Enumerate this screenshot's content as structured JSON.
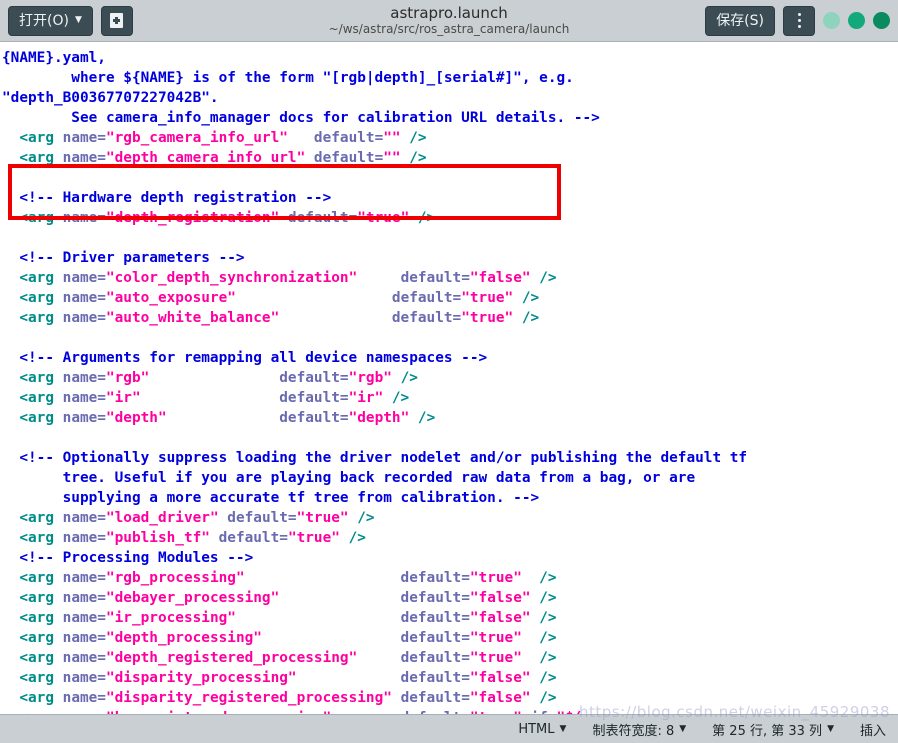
{
  "window": {
    "title": "astrapro.launch",
    "subtitle": "~/ws/astra/src/ros_astra_camera/launch"
  },
  "toolbar": {
    "open_label": "打开(O)",
    "open_caret": "▼",
    "new_doc_icon": "new-document-icon",
    "save_label": "保存(S)",
    "menu_icon": "overflow-menu-icon",
    "window_dots": [
      {
        "name": "minimize-dot",
        "color": "#8ed4bc"
      },
      {
        "name": "maximize-dot",
        "color": "#14a97c"
      },
      {
        "name": "close-dot",
        "color": "#0a8a5f"
      }
    ]
  },
  "statusbar": {
    "language": "HTML",
    "language_caret": "▼",
    "tabwidth": "制表符宽度: 8",
    "tabwidth_caret": "▼",
    "position": "第 25 行, 第 33 列",
    "position_caret": "▼",
    "insert_mode": "插入"
  },
  "watermark": "https://blog.csdn.net/weixin_45929038",
  "annotation": {
    "redbox_color": "#ee0000",
    "note": "red rectangle highlighting the two camera_info_url arg lines"
  },
  "code": {
    "language": "xml",
    "lines": [
      {
        "t": "partial-top",
        "spans": []
      },
      {
        "t": "cm",
        "spans": [
          {
            "c": "cm",
            "x": "{NAME}.yaml,"
          }
        ]
      },
      {
        "t": "cm",
        "spans": [
          {
            "c": "cm",
            "x": "        where ${NAME} is of the form \"[rgb|depth]_[serial#]\", e.g."
          }
        ]
      },
      {
        "t": "cm",
        "spans": [
          {
            "c": "cm",
            "x": "\"depth_B00367707227042B\"."
          }
        ]
      },
      {
        "t": "cm",
        "spans": [
          {
            "c": "cm",
            "x": "        See camera_info_manager docs for calibration URL details. -->"
          }
        ]
      },
      {
        "t": "arg",
        "spans": [
          {
            "c": "tg",
            "x": "  <arg "
          },
          {
            "c": "at",
            "x": "name="
          },
          {
            "c": "st",
            "x": "\"rgb_camera_info_url\""
          },
          {
            "c": "at",
            "x": "   default="
          },
          {
            "c": "st",
            "x": "\"\""
          },
          {
            "c": "tg",
            "x": " />"
          }
        ]
      },
      {
        "t": "arg",
        "spans": [
          {
            "c": "tg",
            "x": "  <arg "
          },
          {
            "c": "at",
            "x": "name="
          },
          {
            "c": "st",
            "x": "\"depth_camera_info_url\""
          },
          {
            "c": "at",
            "x": " default="
          },
          {
            "c": "st",
            "x": "\"\""
          },
          {
            "c": "tg",
            "x": " />"
          }
        ]
      },
      {
        "t": "blank",
        "spans": []
      },
      {
        "t": "cm",
        "spans": [
          {
            "c": "cm",
            "x": "  <!-- Hardware depth registration -->"
          }
        ]
      },
      {
        "t": "arg",
        "spans": [
          {
            "c": "tg",
            "x": "  <arg "
          },
          {
            "c": "at",
            "x": "name="
          },
          {
            "c": "st",
            "x": "\"depth_registration\""
          },
          {
            "c": "at",
            "x": " default="
          },
          {
            "c": "st",
            "x": "\"true\""
          },
          {
            "c": "tg",
            "x": " />"
          }
        ]
      },
      {
        "t": "blank",
        "spans": []
      },
      {
        "t": "cm",
        "spans": [
          {
            "c": "cm",
            "x": "  <!-- Driver parameters -->"
          }
        ]
      },
      {
        "t": "arg",
        "spans": [
          {
            "c": "tg",
            "x": "  <arg "
          },
          {
            "c": "at",
            "x": "name="
          },
          {
            "c": "st",
            "x": "\"color_depth_synchronization\""
          },
          {
            "c": "at",
            "x": "     default="
          },
          {
            "c": "st",
            "x": "\"false\""
          },
          {
            "c": "tg",
            "x": " />"
          }
        ]
      },
      {
        "t": "arg",
        "spans": [
          {
            "c": "tg",
            "x": "  <arg "
          },
          {
            "c": "at",
            "x": "name="
          },
          {
            "c": "st",
            "x": "\"auto_exposure\""
          },
          {
            "c": "at",
            "x": "                  default="
          },
          {
            "c": "st",
            "x": "\"true\""
          },
          {
            "c": "tg",
            "x": " />"
          }
        ]
      },
      {
        "t": "arg",
        "spans": [
          {
            "c": "tg",
            "x": "  <arg "
          },
          {
            "c": "at",
            "x": "name="
          },
          {
            "c": "st",
            "x": "\"auto_white_balance\""
          },
          {
            "c": "at",
            "x": "             default="
          },
          {
            "c": "st",
            "x": "\"true\""
          },
          {
            "c": "tg",
            "x": " />"
          }
        ]
      },
      {
        "t": "blank",
        "spans": []
      },
      {
        "t": "cm",
        "spans": [
          {
            "c": "cm",
            "x": "  <!-- Arguments for remapping all device namespaces -->"
          }
        ]
      },
      {
        "t": "arg",
        "spans": [
          {
            "c": "tg",
            "x": "  <arg "
          },
          {
            "c": "at",
            "x": "name="
          },
          {
            "c": "st",
            "x": "\"rgb\""
          },
          {
            "c": "at",
            "x": "               default="
          },
          {
            "c": "st",
            "x": "\"rgb\""
          },
          {
            "c": "tg",
            "x": " />"
          }
        ]
      },
      {
        "t": "arg",
        "spans": [
          {
            "c": "tg",
            "x": "  <arg "
          },
          {
            "c": "at",
            "x": "name="
          },
          {
            "c": "st",
            "x": "\"ir\""
          },
          {
            "c": "at",
            "x": "                default="
          },
          {
            "c": "st",
            "x": "\"ir\""
          },
          {
            "c": "tg",
            "x": " />"
          }
        ]
      },
      {
        "t": "arg",
        "spans": [
          {
            "c": "tg",
            "x": "  <arg "
          },
          {
            "c": "at",
            "x": "name="
          },
          {
            "c": "st",
            "x": "\"depth\""
          },
          {
            "c": "at",
            "x": "             default="
          },
          {
            "c": "st",
            "x": "\"depth\""
          },
          {
            "c": "tg",
            "x": " />"
          }
        ]
      },
      {
        "t": "blank",
        "spans": []
      },
      {
        "t": "cm",
        "spans": [
          {
            "c": "cm",
            "x": "  <!-- Optionally suppress loading the driver nodelet and/or publishing the default tf"
          }
        ]
      },
      {
        "t": "cm",
        "spans": [
          {
            "c": "cm",
            "x": "       tree. Useful if you are playing back recorded raw data from a bag, or are"
          }
        ]
      },
      {
        "t": "cm",
        "spans": [
          {
            "c": "cm",
            "x": "       supplying a more accurate tf tree from calibration. -->"
          }
        ]
      },
      {
        "t": "arg",
        "spans": [
          {
            "c": "tg",
            "x": "  <arg "
          },
          {
            "c": "at",
            "x": "name="
          },
          {
            "c": "st",
            "x": "\"load_driver\""
          },
          {
            "c": "at",
            "x": " default="
          },
          {
            "c": "st",
            "x": "\"true\""
          },
          {
            "c": "tg",
            "x": " />"
          }
        ]
      },
      {
        "t": "arg",
        "spans": [
          {
            "c": "tg",
            "x": "  <arg "
          },
          {
            "c": "at",
            "x": "name="
          },
          {
            "c": "st",
            "x": "\"publish_tf\""
          },
          {
            "c": "at",
            "x": " default="
          },
          {
            "c": "st",
            "x": "\"true\""
          },
          {
            "c": "tg",
            "x": " />"
          }
        ]
      },
      {
        "t": "cm",
        "spans": [
          {
            "c": "cm",
            "x": "  <!-- Processing Modules -->"
          }
        ]
      },
      {
        "t": "arg",
        "spans": [
          {
            "c": "tg",
            "x": "  <arg "
          },
          {
            "c": "at",
            "x": "name="
          },
          {
            "c": "st",
            "x": "\"rgb_processing\""
          },
          {
            "c": "at",
            "x": "                  default="
          },
          {
            "c": "st",
            "x": "\"true\""
          },
          {
            "c": "tg",
            "x": "  />"
          }
        ]
      },
      {
        "t": "arg",
        "spans": [
          {
            "c": "tg",
            "x": "  <arg "
          },
          {
            "c": "at",
            "x": "name="
          },
          {
            "c": "st",
            "x": "\"debayer_processing\""
          },
          {
            "c": "at",
            "x": "              default="
          },
          {
            "c": "st",
            "x": "\"false\""
          },
          {
            "c": "tg",
            "x": " />"
          }
        ]
      },
      {
        "t": "arg",
        "spans": [
          {
            "c": "tg",
            "x": "  <arg "
          },
          {
            "c": "at",
            "x": "name="
          },
          {
            "c": "st",
            "x": "\"ir_processing\""
          },
          {
            "c": "at",
            "x": "                   default="
          },
          {
            "c": "st",
            "x": "\"false\""
          },
          {
            "c": "tg",
            "x": " />"
          }
        ]
      },
      {
        "t": "arg",
        "spans": [
          {
            "c": "tg",
            "x": "  <arg "
          },
          {
            "c": "at",
            "x": "name="
          },
          {
            "c": "st",
            "x": "\"depth_processing\""
          },
          {
            "c": "at",
            "x": "                default="
          },
          {
            "c": "st",
            "x": "\"true\""
          },
          {
            "c": "tg",
            "x": "  />"
          }
        ]
      },
      {
        "t": "arg",
        "spans": [
          {
            "c": "tg",
            "x": "  <arg "
          },
          {
            "c": "at",
            "x": "name="
          },
          {
            "c": "st",
            "x": "\"depth_registered_processing\""
          },
          {
            "c": "at",
            "x": "     default="
          },
          {
            "c": "st",
            "x": "\"true\""
          },
          {
            "c": "tg",
            "x": "  />"
          }
        ]
      },
      {
        "t": "arg",
        "spans": [
          {
            "c": "tg",
            "x": "  <arg "
          },
          {
            "c": "at",
            "x": "name="
          },
          {
            "c": "st",
            "x": "\"disparity_processing\""
          },
          {
            "c": "at",
            "x": "            default="
          },
          {
            "c": "st",
            "x": "\"false\""
          },
          {
            "c": "tg",
            "x": " />"
          }
        ]
      },
      {
        "t": "arg",
        "spans": [
          {
            "c": "tg",
            "x": "  <arg "
          },
          {
            "c": "at",
            "x": "name="
          },
          {
            "c": "st",
            "x": "\"disparity_registered_processing\""
          },
          {
            "c": "at",
            "x": " default="
          },
          {
            "c": "st",
            "x": "\"false\""
          },
          {
            "c": "tg",
            "x": " />"
          }
        ]
      },
      {
        "t": "arg",
        "spans": [
          {
            "c": "tg",
            "x": "  <arg "
          },
          {
            "c": "at",
            "x": "name="
          },
          {
            "c": "st",
            "x": "\"hw_registered_processing\""
          },
          {
            "c": "at",
            "x": "        default="
          },
          {
            "c": "st",
            "x": "\"true\""
          },
          {
            "c": "at",
            "x": " if="
          },
          {
            "c": "st",
            "x": "\"$(arg"
          }
        ]
      }
    ]
  }
}
